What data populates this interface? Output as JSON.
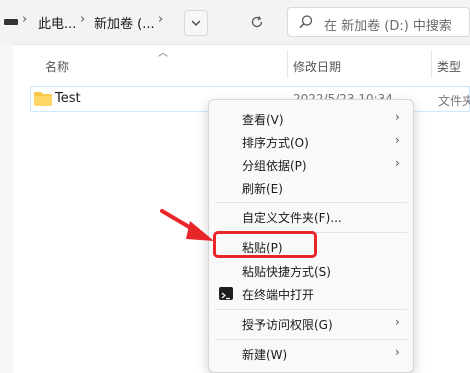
{
  "toolbar": {
    "breadcrumb": [
      {
        "label": "此电..."
      },
      {
        "label": "新加卷 (..."
      }
    ],
    "search_placeholder": "在 新加卷 (D:) 中搜索"
  },
  "columns": {
    "name": "名称",
    "modified": "修改日期",
    "type": "类型"
  },
  "files": [
    {
      "name": "Test",
      "modified": "2022/5/23 10:34",
      "type": "文件夹"
    }
  ],
  "context_menu": {
    "view": "查看(V)",
    "sort": "排序方式(O)",
    "group": "分组依据(P)",
    "refresh": "刷新(E)",
    "customize": "自定义文件夹(F)...",
    "paste": "粘贴(P)",
    "paste_shortcut": "粘贴快捷方式(S)",
    "open_terminal": "在终端中打开",
    "grant_access": "授予访问权限(G)",
    "new": "新建(W)"
  },
  "colors": {
    "highlight": "#e8262a",
    "folder": "#f6c845",
    "selection_border": "#cce8ff"
  }
}
